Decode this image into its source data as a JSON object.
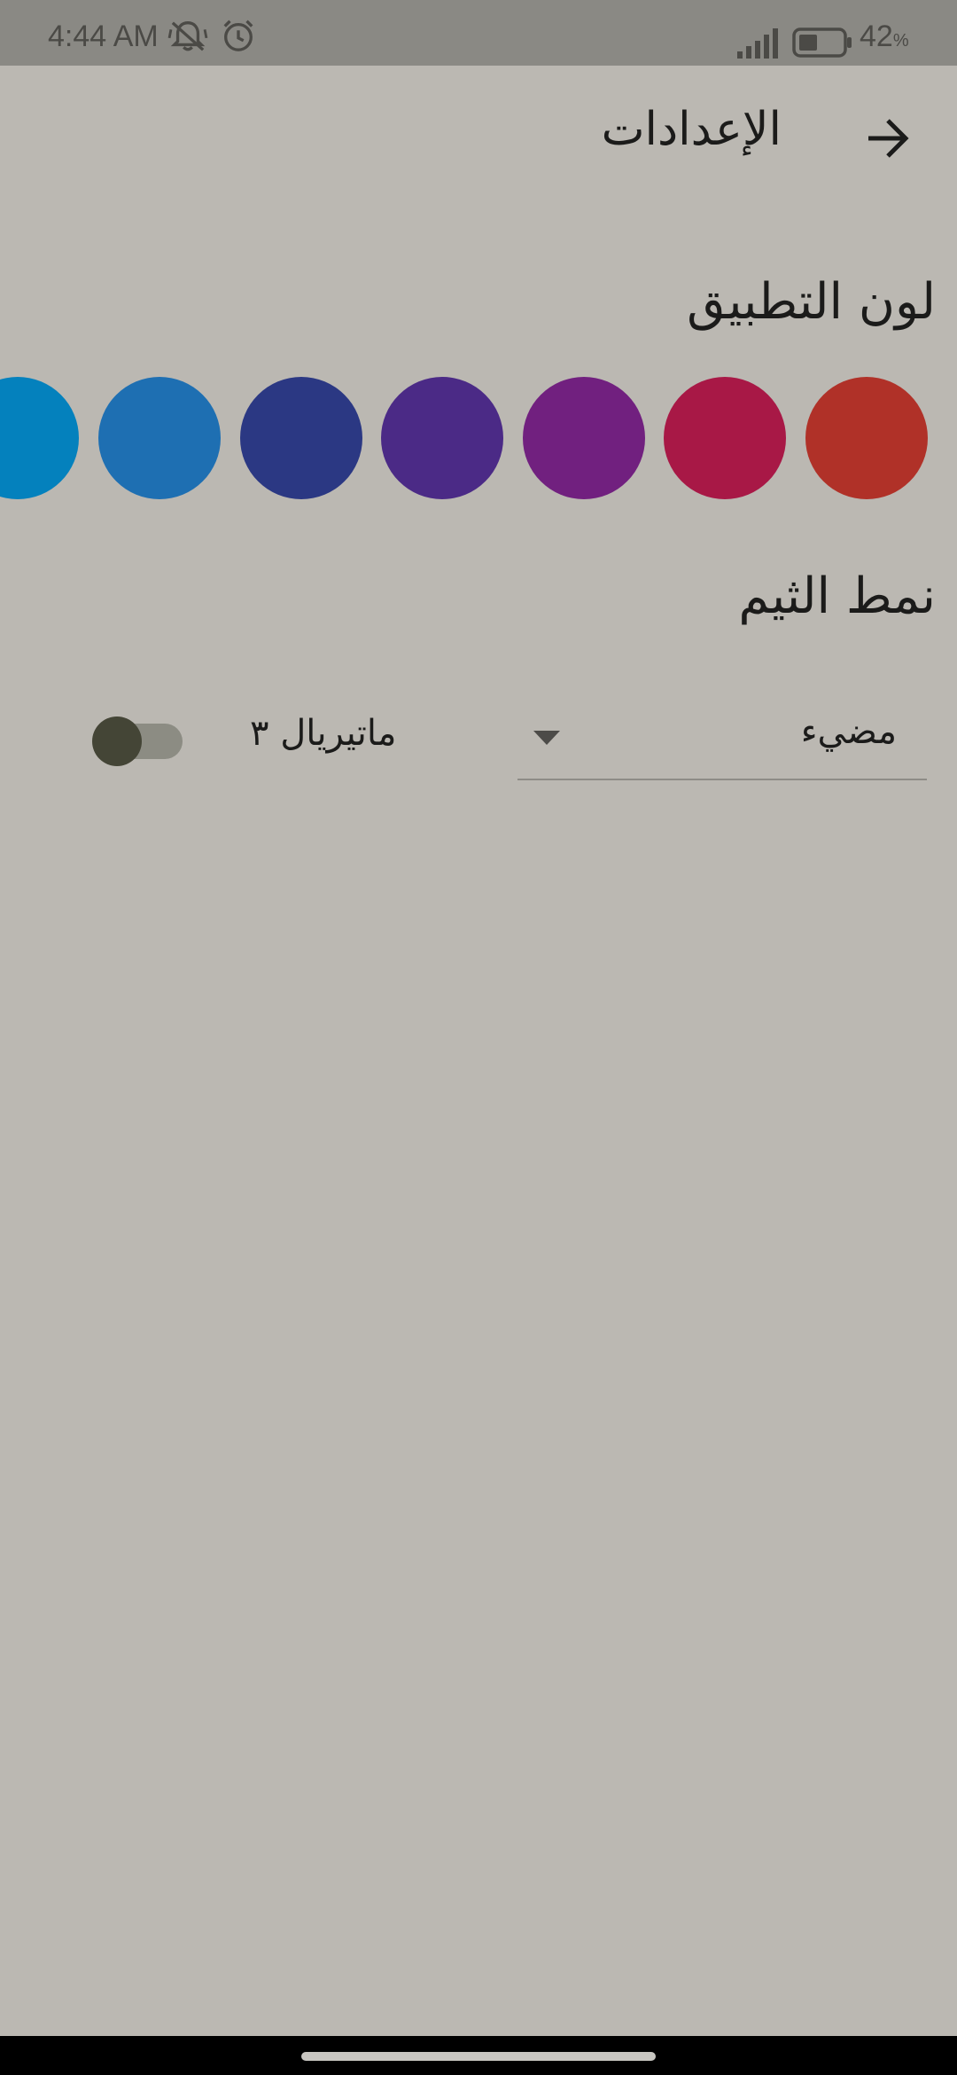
{
  "status_bar": {
    "time": "4:44 AM",
    "battery_percent": "42",
    "battery_unit": "%",
    "icons": [
      "silent-bell-icon",
      "alarm-icon",
      "signal-icon",
      "battery-icon"
    ]
  },
  "app_bar": {
    "title": "الإعدادات",
    "back_icon": "arrow-forward-icon"
  },
  "app_color": {
    "heading": "لون التطبيق",
    "swatches": [
      "#b03128",
      "#a81846",
      "#71207f",
      "#4b2a86",
      "#2b3883",
      "#1e6fb2",
      "#0481bd"
    ]
  },
  "theme_mode": {
    "heading": "نمط الثيم",
    "selected": "مضيء",
    "material_label": "ماتيريال ٣",
    "material_enabled": false
  }
}
